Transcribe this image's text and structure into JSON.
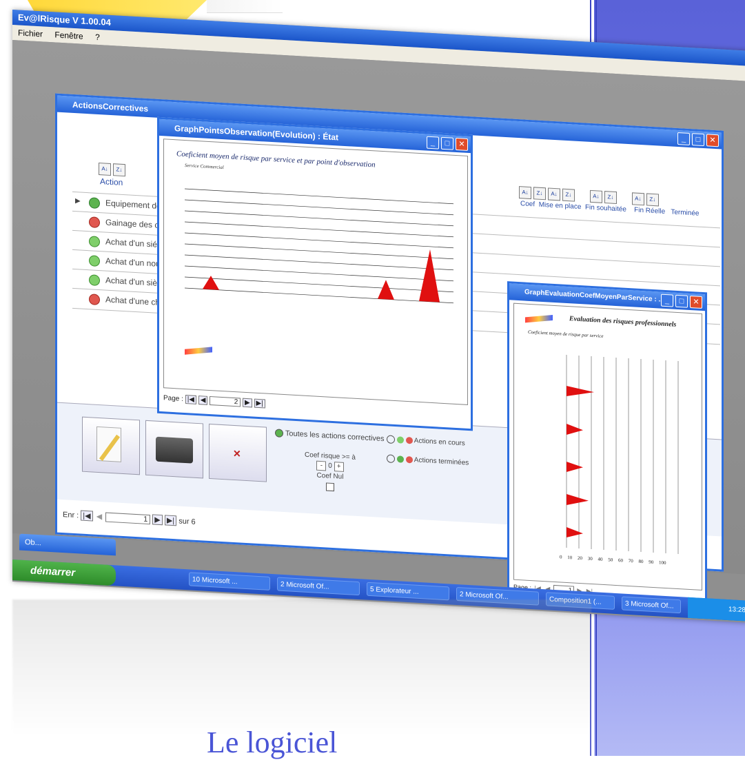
{
  "app": {
    "title": "Ev@lRisque V 1.00.04",
    "menu": [
      "Fichier",
      "Fenêtre",
      "?"
    ]
  },
  "actions_window": {
    "title": "ActionsCorrectives",
    "columns": {
      "action": "Action",
      "coef": "Coef",
      "mise_en_place": "Mise en place",
      "fin_souhaitee": "Fin souhaitée",
      "fin_reelle": "Fin Réelle",
      "terminee": "Terminée"
    },
    "rows": [
      {
        "label": "Equipement de",
        "status": "done"
      },
      {
        "label": "Gainage des c",
        "status": "cancelled"
      },
      {
        "label": "Achat d'un siég",
        "status": "ok"
      },
      {
        "label": "Achat d'un nouv",
        "status": "ok"
      },
      {
        "label": "Achat d'un sièg",
        "status": "ok"
      },
      {
        "label": "Achat d'une che",
        "status": "cancelled"
      }
    ],
    "filters": {
      "all": "Toutes les actions correctives",
      "in_progress": "Actions en cours",
      "finished": "Actions terminées",
      "coef_label": "Coef risque >= à",
      "coef_value": "0",
      "coef_null": "Coef Nul"
    },
    "nav": {
      "label": "Enr :",
      "current": "1",
      "total": "sur 6"
    }
  },
  "graph_points": {
    "title": "GraphPointsObservation(Evolution) : État",
    "heading": "Coeficient moyen de risque par service et par point d'observation",
    "service": "Service Commercial",
    "nav": {
      "label": "Page :",
      "current": "2"
    }
  },
  "graph_eval": {
    "title": "GraphEvaluationCoefMoyenParService : ...",
    "heading": "Evaluation des risques professionnels",
    "subheading": "Coeficient moyen de risque par service",
    "xticks": [
      "0",
      "10",
      "20",
      "30",
      "40",
      "50",
      "60",
      "70",
      "80",
      "90",
      "100"
    ],
    "nav": {
      "label": "Page :",
      "current": "1"
    }
  },
  "taskbar": {
    "start": "démarrer",
    "items": [
      "10 Microsoft ...",
      "2 Microsoft Of...",
      "5 Explorateur ...",
      "2 Microsoft Of...",
      "Composition1 (...",
      "3 Microsoft Of..."
    ],
    "clock": "13:28",
    "minimized": "Ob..."
  },
  "caption": "Le logiciel"
}
